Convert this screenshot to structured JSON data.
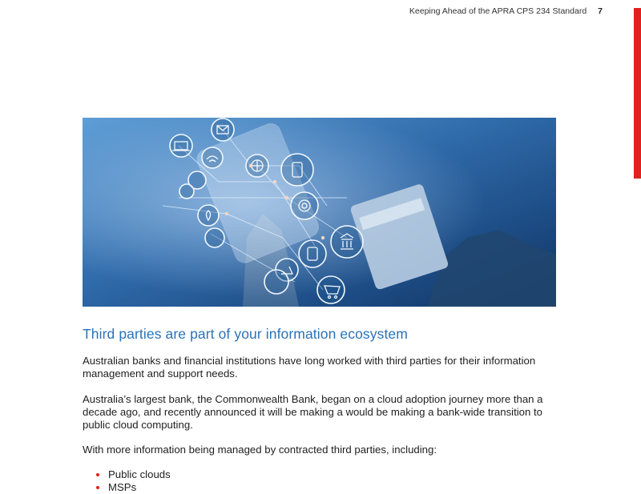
{
  "header": {
    "title": "Keeping Ahead of the APRA CPS 234 Standard",
    "page_number": "7"
  },
  "colors": {
    "accent": "#e3201b",
    "heading": "#2a72b8",
    "banner_base": "#123e6e"
  },
  "hero": {
    "icons": [
      "mail-icon",
      "laptop-icon",
      "wifi-icon",
      "globe-icon",
      "tablet-icon",
      "dollar-icon",
      "settings-icon",
      "location-icon",
      "bank-icon",
      "smartphone-icon",
      "chart-icon",
      "cart-icon",
      "user-icon"
    ]
  },
  "section": {
    "heading": "Third parties are part of your information ecosystem",
    "paragraphs": [
      "Australian banks and financial institutions have long worked with third parties for their information management and support needs.",
      "Australia’s largest bank, the Commonwealth Bank, began on a cloud adoption journey more than a decade ago, and recently announced it will be making a would be making a bank-wide transition to public cloud computing.",
      "With more information being managed by contracted third parties, including:"
    ],
    "bullets": [
      "Public clouds",
      "MSPs"
    ]
  }
}
